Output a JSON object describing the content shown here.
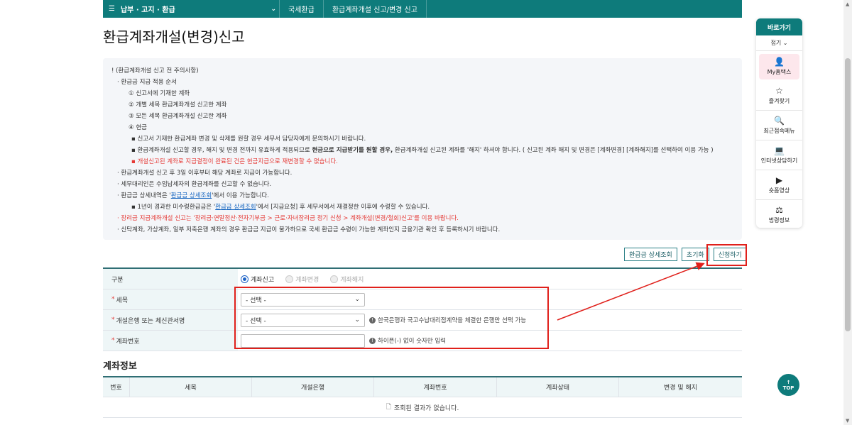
{
  "nav": {
    "menu": "납부 · 고지 · 환급",
    "crumb1": "국세환급",
    "crumb2": "환급계좌개설 신고/변경 신고"
  },
  "page_title": "환급계좌개설(변경)신고",
  "notice": {
    "heading": "! (환급계좌개설 신고 전 주의사항)",
    "l1": "환급금 지급 적용 순서",
    "l2": "① 신고서에 기재한 계좌",
    "l3": "② 개별 세목 환급계좌개설 신고한 계좌",
    "l4": "③ 모든 세목 환급계좌개설 신고한 계좌",
    "l5": "④ 현금",
    "l6": "신고서 기재한 환급계좌 변경 및 삭제를 원할 경우 세무서 담당자에게 문의하시기 바랍니다.",
    "l7a": "환급계좌개설 신고할 경우, 해지 및 변경 전까지 유효하게 적용되므로 ",
    "l7b": "현금으로 지급받기를 원할 경우,",
    "l7c": " 환급계좌개설 신고된 계좌를 '해지' 하셔야 합니다. ( 신고된 계좌 해지 및 변경은 [계좌변경] [계좌해지]를 선택하여 이용 가능 )",
    "l8": "개설신고된 계좌로 지급결정이 완료된 건은 현금지급으로 재변경할 수 없습니다.",
    "l9": "환급계좌개설 신고 후 3일 이후부터 해당 계좌로 지급이 가능합니다.",
    "l10": "세무대리인은 수임납세자의 환급계좌를 신고할 수 없습니다.",
    "l11a": "환급금 상세내역은 '",
    "l11b": "환급금 상세조회",
    "l11c": "'에서 이용 가능합니다.",
    "l12a": "1년이 경과한 미수령환급금은 '",
    "l12b": "환급금 상세조회",
    "l12c": "'에서 [지급요청] 후 세무서에서 재결정한 이후에 수령할 수 있습니다.",
    "l13": "장려금 지급계좌개설 신고는 '장려금·연말정산·전자기부금 > 근로·자녀장려금 정기 신청 > 계좌개설(변경/철회)신고'를 이용 바랍니다.",
    "l14": "신탁계좌, 가상계좌, 일부 저축은행 계좌의 경우 환급금 지급이 불가하므로 국세 환급금 수령이 가능한 계좌인지 금융기관 확인 후 등록하시기 바랍니다."
  },
  "buttons": {
    "detail": "환급금 상세조회",
    "reset": "초기화",
    "apply": "신청하기"
  },
  "form": {
    "type_label": "구분",
    "type_options": [
      "계좌신고",
      "계좌변경",
      "계좌해지"
    ],
    "tax_label": "세목",
    "tax_value": "- 선택 -",
    "bank_label": "개설은행 또는 체신관서명",
    "bank_value": "- 선택 -",
    "bank_hint": "한국은행과 국고수납대리점계약을 체결한 은행만 선택 가능",
    "acct_label": "계좌번호",
    "acct_hint": "하이픈(-) 없이 숫자만 입력"
  },
  "account_info": {
    "title": "계좌정보",
    "columns": [
      "번호",
      "세목",
      "개설은행",
      "계좌번호",
      "계좌상태",
      "변경 및 해지"
    ],
    "empty_message": "조회된 결과가 없습니다."
  },
  "sidebar": {
    "title": "바로가기",
    "fold": "접기",
    "items": [
      "My홈택스",
      "즐겨찾기",
      "최근접속메뉴",
      "인터넷상담하기",
      "숏폼영상",
      "법령정보"
    ]
  },
  "top_button": "TOP",
  "colors": {
    "brand": "#0e7b7b",
    "highlight": "#e0201b"
  }
}
